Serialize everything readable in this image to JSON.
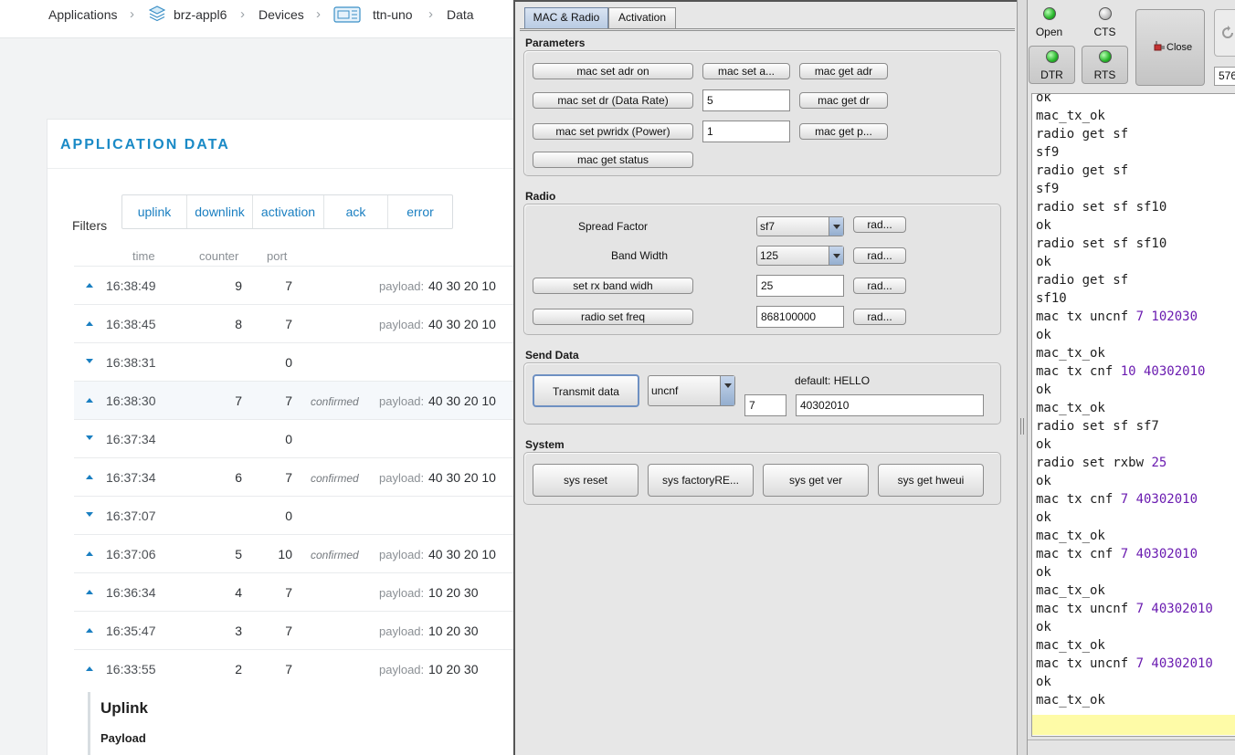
{
  "breadcrumb": {
    "applications": "Applications",
    "app_name": "brz-appl6",
    "devices": "Devices",
    "device_name": "ttn-uno",
    "data": "Data"
  },
  "app_data": {
    "title": "APPLICATION DATA",
    "filters_label": "Filters",
    "filters": [
      "uplink",
      "downlink",
      "activation",
      "ack",
      "error"
    ],
    "columns": {
      "time": "time",
      "counter": "counter",
      "port": "port"
    },
    "payload_label": "payload:",
    "rows": [
      {
        "dir": "up",
        "time": "16:38:49",
        "counter": "9",
        "port": "7",
        "confirmed": "",
        "payload": "40 30 20 10"
      },
      {
        "dir": "up",
        "time": "16:38:45",
        "counter": "8",
        "port": "7",
        "confirmed": "",
        "payload": "40 30 20 10"
      },
      {
        "dir": "down",
        "time": "16:38:31",
        "counter": "",
        "port": "0",
        "confirmed": "",
        "payload": ""
      },
      {
        "dir": "up",
        "time": "16:38:30",
        "counter": "7",
        "port": "7",
        "confirmed": "confirmed",
        "payload": "40 30 20 10"
      },
      {
        "dir": "down",
        "time": "16:37:34",
        "counter": "",
        "port": "0",
        "confirmed": "",
        "payload": ""
      },
      {
        "dir": "up",
        "time": "16:37:34",
        "counter": "6",
        "port": "7",
        "confirmed": "confirmed",
        "payload": "40 30 20 10"
      },
      {
        "dir": "down",
        "time": "16:37:07",
        "counter": "",
        "port": "0",
        "confirmed": "",
        "payload": ""
      },
      {
        "dir": "up",
        "time": "16:37:06",
        "counter": "5",
        "port": "10",
        "confirmed": "confirmed",
        "payload": "40 30 20 10"
      },
      {
        "dir": "up",
        "time": "16:36:34",
        "counter": "4",
        "port": "7",
        "confirmed": "",
        "payload": "10 20 30"
      },
      {
        "dir": "up",
        "time": "16:35:47",
        "counter": "3",
        "port": "7",
        "confirmed": "",
        "payload": "10 20 30"
      },
      {
        "dir": "up",
        "time": "16:33:55",
        "counter": "2",
        "port": "7",
        "confirmed": "",
        "payload": "10 20 30"
      }
    ],
    "detail": {
      "uplink": "Uplink",
      "payload": "Payload"
    }
  },
  "swing": {
    "tabs": [
      "MAC & Radio",
      "Activation"
    ],
    "parameters": {
      "label": "Parameters",
      "mac_set_adr_on": "mac set adr on",
      "mac_set_a": "mac set a...",
      "mac_get_adr": "mac get adr",
      "mac_set_dr": "mac set dr (Data Rate)",
      "dr_value": "5",
      "mac_get_dr": "mac get dr",
      "mac_set_pwridx": "mac set pwridx (Power)",
      "pwr_value": "1",
      "mac_get_p": "mac get p...",
      "mac_get_status": "mac get status"
    },
    "radio": {
      "label": "Radio",
      "spread_factor_label": "Spread Factor",
      "spread_factor": "sf7",
      "band_width_label": "Band Width",
      "band_width": "125",
      "rad": "rad...",
      "set_rx_bw": "set rx band widh",
      "rx_bw_value": "25",
      "radio_set_freq": "radio set freq",
      "freq_value": "868100000"
    },
    "send": {
      "label": "Send Data",
      "transmit": "Transmit data",
      "mode": "uncnf",
      "default_hint": "default: HELLO",
      "port": "7",
      "data": "40302010"
    },
    "system": {
      "label": "System",
      "sys_reset": "sys reset",
      "sys_factory": "sys factoryRE...",
      "sys_get_ver": "sys get ver",
      "sys_get_hweui": "sys get hweui"
    }
  },
  "terminal": {
    "leds": {
      "open": "Open",
      "cts": "CTS",
      "dtr": "DTR",
      "rts": "RTS"
    },
    "close_label": "Close",
    "baud": "576",
    "lines": [
      [
        "ok",
        ""
      ],
      [
        "mac_tx_ok",
        ""
      ],
      [
        "radio get sf",
        ""
      ],
      [
        "sf9",
        ""
      ],
      [
        "radio get sf",
        ""
      ],
      [
        "sf9",
        ""
      ],
      [
        "radio set sf sf10",
        ""
      ],
      [
        "ok",
        ""
      ],
      [
        "radio set sf sf10",
        ""
      ],
      [
        "ok",
        ""
      ],
      [
        "radio get sf",
        ""
      ],
      [
        "sf10",
        ""
      ],
      [
        "mac tx uncnf ",
        "7 102030"
      ],
      [
        "ok",
        ""
      ],
      [
        "mac_tx_ok",
        ""
      ],
      [
        "mac tx cnf ",
        "10 40302010"
      ],
      [
        "ok",
        ""
      ],
      [
        "mac_tx_ok",
        ""
      ],
      [
        "radio set sf sf7",
        ""
      ],
      [
        "ok",
        ""
      ],
      [
        "radio set rxbw ",
        "25"
      ],
      [
        "ok",
        ""
      ],
      [
        "mac tx cnf ",
        "7 40302010"
      ],
      [
        "ok",
        ""
      ],
      [
        "mac_tx_ok",
        ""
      ],
      [
        "mac tx cnf ",
        "7 40302010"
      ],
      [
        "ok",
        ""
      ],
      [
        "mac_tx_ok",
        ""
      ],
      [
        "mac tx uncnf ",
        "7 40302010"
      ],
      [
        "ok",
        ""
      ],
      [
        "mac_tx_ok",
        ""
      ],
      [
        "mac tx uncnf ",
        "7 40302010"
      ],
      [
        "ok",
        ""
      ],
      [
        "mac_tx_ok",
        ""
      ]
    ]
  }
}
